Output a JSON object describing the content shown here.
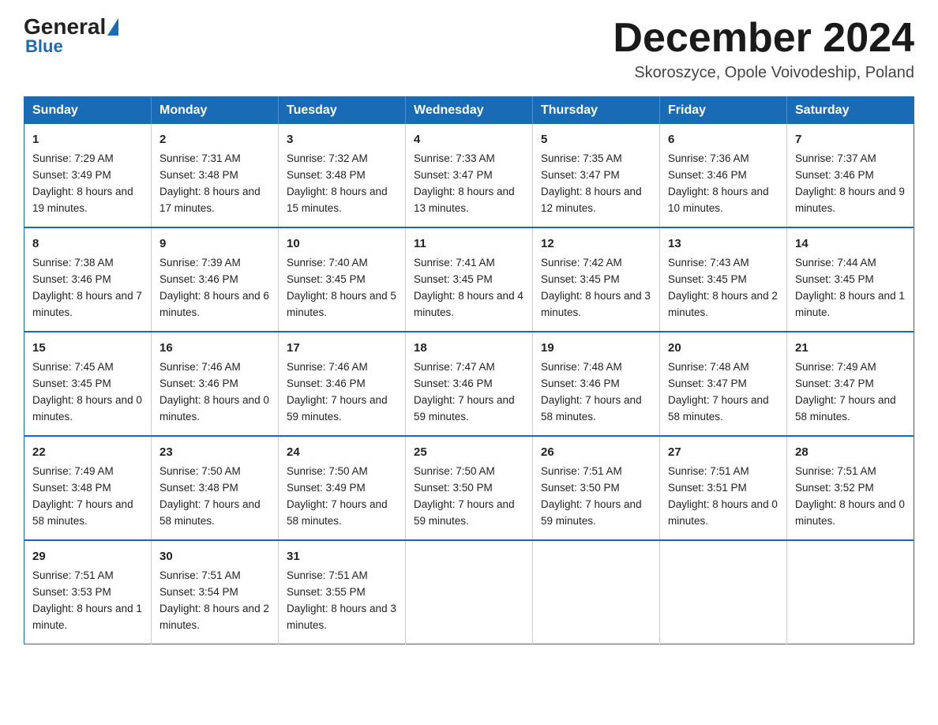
{
  "header": {
    "logo_general": "General",
    "logo_blue": "Blue",
    "month_year": "December 2024",
    "location": "Skoroszyce, Opole Voivodeship, Poland"
  },
  "calendar": {
    "weekdays": [
      "Sunday",
      "Monday",
      "Tuesday",
      "Wednesday",
      "Thursday",
      "Friday",
      "Saturday"
    ],
    "weeks": [
      [
        {
          "day": "1",
          "sunrise": "7:29 AM",
          "sunset": "3:49 PM",
          "daylight": "8 hours and 19 minutes."
        },
        {
          "day": "2",
          "sunrise": "7:31 AM",
          "sunset": "3:48 PM",
          "daylight": "8 hours and 17 minutes."
        },
        {
          "day": "3",
          "sunrise": "7:32 AM",
          "sunset": "3:48 PM",
          "daylight": "8 hours and 15 minutes."
        },
        {
          "day": "4",
          "sunrise": "7:33 AM",
          "sunset": "3:47 PM",
          "daylight": "8 hours and 13 minutes."
        },
        {
          "day": "5",
          "sunrise": "7:35 AM",
          "sunset": "3:47 PM",
          "daylight": "8 hours and 12 minutes."
        },
        {
          "day": "6",
          "sunrise": "7:36 AM",
          "sunset": "3:46 PM",
          "daylight": "8 hours and 10 minutes."
        },
        {
          "day": "7",
          "sunrise": "7:37 AM",
          "sunset": "3:46 PM",
          "daylight": "8 hours and 9 minutes."
        }
      ],
      [
        {
          "day": "8",
          "sunrise": "7:38 AM",
          "sunset": "3:46 PM",
          "daylight": "8 hours and 7 minutes."
        },
        {
          "day": "9",
          "sunrise": "7:39 AM",
          "sunset": "3:46 PM",
          "daylight": "8 hours and 6 minutes."
        },
        {
          "day": "10",
          "sunrise": "7:40 AM",
          "sunset": "3:45 PM",
          "daylight": "8 hours and 5 minutes."
        },
        {
          "day": "11",
          "sunrise": "7:41 AM",
          "sunset": "3:45 PM",
          "daylight": "8 hours and 4 minutes."
        },
        {
          "day": "12",
          "sunrise": "7:42 AM",
          "sunset": "3:45 PM",
          "daylight": "8 hours and 3 minutes."
        },
        {
          "day": "13",
          "sunrise": "7:43 AM",
          "sunset": "3:45 PM",
          "daylight": "8 hours and 2 minutes."
        },
        {
          "day": "14",
          "sunrise": "7:44 AM",
          "sunset": "3:45 PM",
          "daylight": "8 hours and 1 minute."
        }
      ],
      [
        {
          "day": "15",
          "sunrise": "7:45 AM",
          "sunset": "3:45 PM",
          "daylight": "8 hours and 0 minutes."
        },
        {
          "day": "16",
          "sunrise": "7:46 AM",
          "sunset": "3:46 PM",
          "daylight": "8 hours and 0 minutes."
        },
        {
          "day": "17",
          "sunrise": "7:46 AM",
          "sunset": "3:46 PM",
          "daylight": "7 hours and 59 minutes."
        },
        {
          "day": "18",
          "sunrise": "7:47 AM",
          "sunset": "3:46 PM",
          "daylight": "7 hours and 59 minutes."
        },
        {
          "day": "19",
          "sunrise": "7:48 AM",
          "sunset": "3:46 PM",
          "daylight": "7 hours and 58 minutes."
        },
        {
          "day": "20",
          "sunrise": "7:48 AM",
          "sunset": "3:47 PM",
          "daylight": "7 hours and 58 minutes."
        },
        {
          "day": "21",
          "sunrise": "7:49 AM",
          "sunset": "3:47 PM",
          "daylight": "7 hours and 58 minutes."
        }
      ],
      [
        {
          "day": "22",
          "sunrise": "7:49 AM",
          "sunset": "3:48 PM",
          "daylight": "7 hours and 58 minutes."
        },
        {
          "day": "23",
          "sunrise": "7:50 AM",
          "sunset": "3:48 PM",
          "daylight": "7 hours and 58 minutes."
        },
        {
          "day": "24",
          "sunrise": "7:50 AM",
          "sunset": "3:49 PM",
          "daylight": "7 hours and 58 minutes."
        },
        {
          "day": "25",
          "sunrise": "7:50 AM",
          "sunset": "3:50 PM",
          "daylight": "7 hours and 59 minutes."
        },
        {
          "day": "26",
          "sunrise": "7:51 AM",
          "sunset": "3:50 PM",
          "daylight": "7 hours and 59 minutes."
        },
        {
          "day": "27",
          "sunrise": "7:51 AM",
          "sunset": "3:51 PM",
          "daylight": "8 hours and 0 minutes."
        },
        {
          "day": "28",
          "sunrise": "7:51 AM",
          "sunset": "3:52 PM",
          "daylight": "8 hours and 0 minutes."
        }
      ],
      [
        {
          "day": "29",
          "sunrise": "7:51 AM",
          "sunset": "3:53 PM",
          "daylight": "8 hours and 1 minute."
        },
        {
          "day": "30",
          "sunrise": "7:51 AM",
          "sunset": "3:54 PM",
          "daylight": "8 hours and 2 minutes."
        },
        {
          "day": "31",
          "sunrise": "7:51 AM",
          "sunset": "3:55 PM",
          "daylight": "8 hours and 3 minutes."
        },
        null,
        null,
        null,
        null
      ]
    ],
    "labels": {
      "sunrise": "Sunrise:",
      "sunset": "Sunset:",
      "daylight": "Daylight:"
    }
  }
}
